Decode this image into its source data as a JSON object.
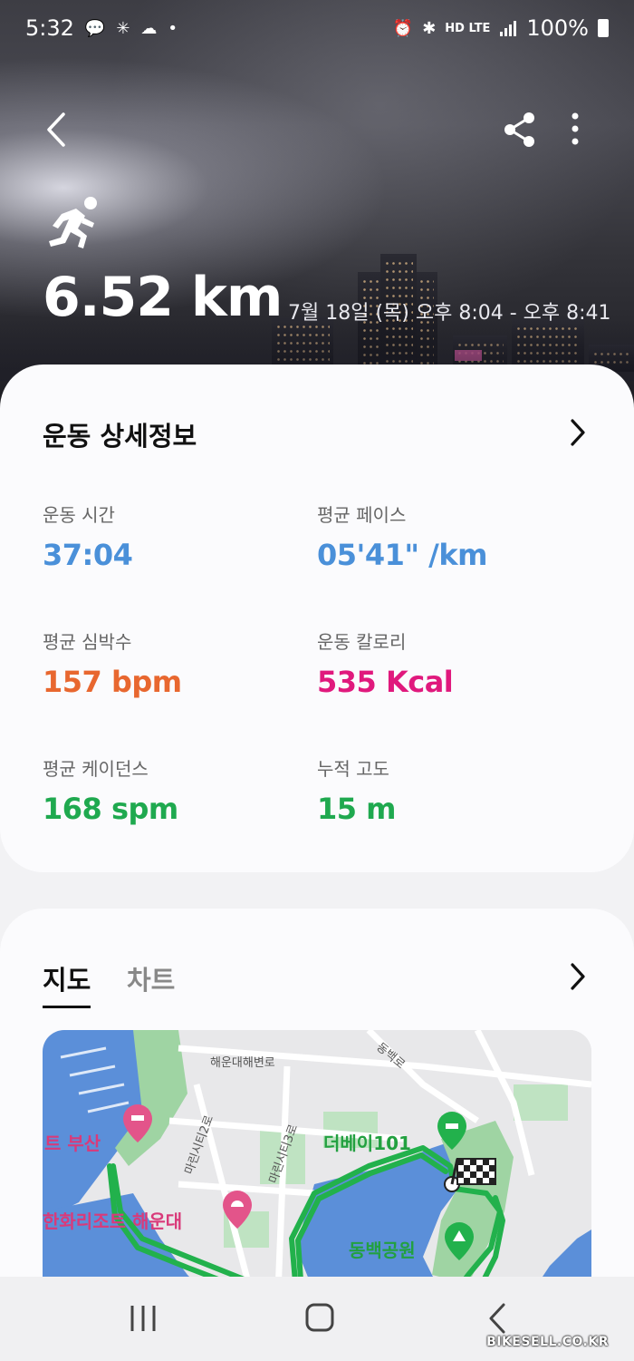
{
  "status_bar": {
    "time": "5:32",
    "network_labels": "HD LTE",
    "battery": "100%"
  },
  "workout": {
    "distance": "6.52 km",
    "datetime": "7월 18일 (목) 오후 8:04 - 오후 8:41"
  },
  "details": {
    "title": "운동 상세정보",
    "metrics": [
      {
        "label": "운동 시간",
        "value": "37:04",
        "color": "#4a90d9"
      },
      {
        "label": "평균 페이스",
        "value": "05'41\" /km",
        "color": "#4a90d9"
      },
      {
        "label": "평균 심박수",
        "value": "157 bpm",
        "color": "#e8672f"
      },
      {
        "label": "운동 칼로리",
        "value": "535 Kcal",
        "color": "#e0197d"
      },
      {
        "label": "평균 케이던스",
        "value": "168 spm",
        "color": "#1fa94f"
      },
      {
        "label": "누적 고도",
        "value": "15 m",
        "color": "#1fa94f"
      }
    ]
  },
  "map_section": {
    "tabs": [
      "지도",
      "차트"
    ],
    "active_tab": "지도",
    "labels": {
      "road1": "해운대해변로",
      "road2": "동백로",
      "road3": "마린시티2로",
      "road4": "마린시티3로",
      "poi1": "트 부산",
      "poi2": "한화리조트 해운대",
      "poi3": "더베이101",
      "poi4": "동백공원"
    },
    "route_color": "#22b14c"
  },
  "watermark": "BIKESELL.CO.KR"
}
